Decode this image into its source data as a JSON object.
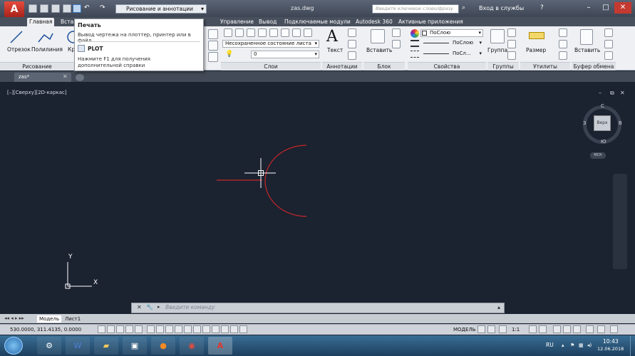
{
  "title": {
    "doc": "zas.dwg",
    "workspace": "Рисование и аннотации",
    "search_placeholder": "Введите ключевое слово/фразу",
    "signin": "Вход в службы"
  },
  "ribbon_tabs": [
    "Главная",
    "Вставка",
    "Управление",
    "Вывод",
    "Подключаемые модули",
    "Autodesk 360",
    "Активные приложения"
  ],
  "draw_panel": {
    "line": "Отрезок",
    "polyline": "Полилиния",
    "circle": "Кр",
    "label": "Рисование"
  },
  "tooltip": {
    "title": "Печать",
    "desc": "Вывод чертежа на плоттер, принтер или в файл",
    "cmd": "PLOT",
    "help": "Нажмите F1 для получения дополнительной справки"
  },
  "layers": {
    "state": "Несохраненное состояние листа",
    "current": "0",
    "label": "Слои"
  },
  "annotation": {
    "text": "Текст",
    "label": "Аннотации"
  },
  "block": {
    "insert": "Вставить",
    "label": "Блок"
  },
  "properties": {
    "color": "ПоСлою",
    "linetype": "ПоСлою",
    "lineweight": "ПоСл...",
    "label": "Свойства"
  },
  "groups": {
    "group": "Группа",
    "label": "Группы"
  },
  "utilities": {
    "measure": "Размер",
    "label": "Утилиты"
  },
  "clipboard": {
    "paste": "Вставить",
    "label": "Буфер обмена"
  },
  "doc_tab": "zas*",
  "viewport_label": "[–][Сверху][2D-каркас]",
  "viewcube": {
    "face": "Верх",
    "n": "С",
    "s": "Ю",
    "e": "В",
    "w": "З",
    "wcs": "МСК"
  },
  "ucs": {
    "x": "X",
    "y": "Y"
  },
  "command_placeholder": "Введите команду",
  "layout_tabs": [
    "Модель",
    "Лист1"
  ],
  "status": {
    "coords": "530.0000, 311.4135, 0.0000",
    "mode": "МОДЕЛЬ",
    "scale": "1:1"
  },
  "tray": {
    "lang": "RU",
    "time": "10:43",
    "date": "12.06.2018"
  },
  "colors": {
    "accent": "#c62828",
    "background": "#1b2230"
  }
}
